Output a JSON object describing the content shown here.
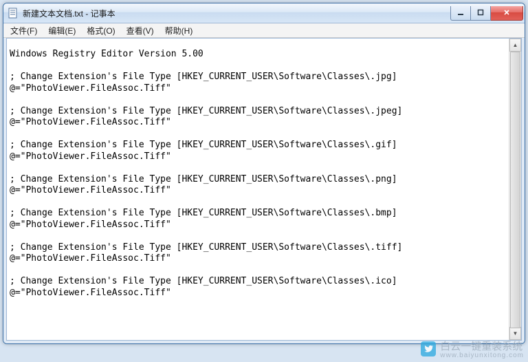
{
  "window": {
    "title": "新建文本文档.txt - 记事本"
  },
  "menubar": {
    "file": "文件(F)",
    "edit": "编辑(E)",
    "format": "格式(O)",
    "view": "查看(V)",
    "help": "帮助(H)"
  },
  "document": {
    "text": "Windows Registry Editor Version 5.00\n\n; Change Extension's File Type [HKEY_CURRENT_USER\\Software\\Classes\\.jpg]\n@=\"PhotoViewer.FileAssoc.Tiff\"\n\n; Change Extension's File Type [HKEY_CURRENT_USER\\Software\\Classes\\.jpeg]\n@=\"PhotoViewer.FileAssoc.Tiff\"\n\n; Change Extension's File Type [HKEY_CURRENT_USER\\Software\\Classes\\.gif]\n@=\"PhotoViewer.FileAssoc.Tiff\"\n\n; Change Extension's File Type [HKEY_CURRENT_USER\\Software\\Classes\\.png]\n@=\"PhotoViewer.FileAssoc.Tiff\"\n\n; Change Extension's File Type [HKEY_CURRENT_USER\\Software\\Classes\\.bmp]\n@=\"PhotoViewer.FileAssoc.Tiff\"\n\n; Change Extension's File Type [HKEY_CURRENT_USER\\Software\\Classes\\.tiff]\n@=\"PhotoViewer.FileAssoc.Tiff\"\n\n; Change Extension's File Type [HKEY_CURRENT_USER\\Software\\Classes\\.ico]\n@=\"PhotoViewer.FileAssoc.Tiff\"\n"
  },
  "watermark": {
    "brand": "白云一键重装系统",
    "url": "www.baiyunxitong.com"
  }
}
